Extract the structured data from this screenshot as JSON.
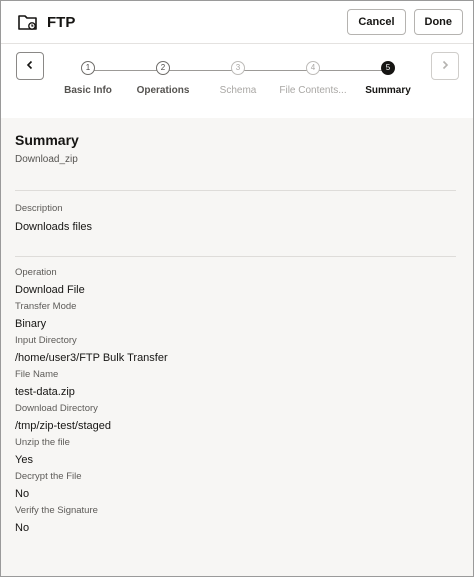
{
  "header": {
    "title": "FTP",
    "cancel_label": "Cancel",
    "done_label": "Done"
  },
  "train": {
    "steps": [
      {
        "number": "1",
        "label": "Basic Info",
        "state": "visited"
      },
      {
        "number": "2",
        "label": "Operations",
        "state": "visited"
      },
      {
        "number": "3",
        "label": "Schema",
        "state": "disabled"
      },
      {
        "number": "4",
        "label": "File Contents...",
        "state": "disabled"
      },
      {
        "number": "5",
        "label": "Summary",
        "state": "active"
      }
    ]
  },
  "summary": {
    "title": "Summary",
    "subtitle": "Download_zip",
    "description_label": "Description",
    "description_value": "Downloads files",
    "fields": [
      {
        "label": "Operation",
        "value": "Download File"
      },
      {
        "label": "Transfer Mode",
        "value": "Binary"
      },
      {
        "label": "Input Directory",
        "value": "/home/user3/FTP Bulk Transfer"
      },
      {
        "label": "File Name",
        "value": "test-data.zip"
      },
      {
        "label": "Download Directory",
        "value": "/tmp/zip-test/staged"
      },
      {
        "label": "Unzip the file",
        "value": "Yes"
      },
      {
        "label": "Decrypt the File",
        "value": "No"
      },
      {
        "label": "Verify the Signature",
        "value": "No"
      }
    ]
  },
  "colors": {
    "active_step": "#161513",
    "content_bg": "#f7f6f4"
  }
}
